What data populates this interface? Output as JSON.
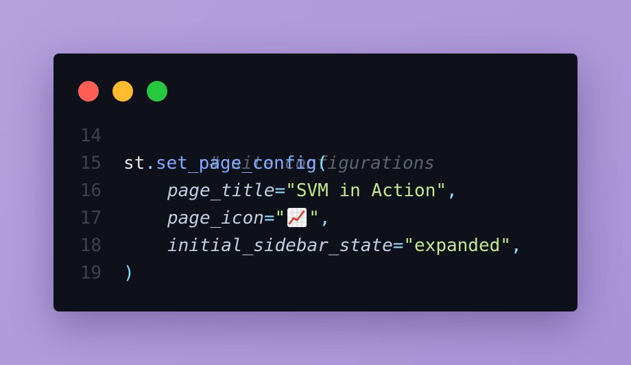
{
  "window": {
    "controls": [
      "close",
      "minimize",
      "maximize"
    ]
  },
  "code": {
    "lines": [
      {
        "number": "14",
        "comment": "# site configurations"
      },
      {
        "number": "15",
        "obj": "st",
        "dot": ".",
        "func": "set_page_config",
        "paren": "("
      },
      {
        "number": "16",
        "param": "page_title",
        "eq": "=",
        "value": "\"SVM in Action\"",
        "comma": ","
      },
      {
        "number": "17",
        "param": "page_icon",
        "eq": "=",
        "q1": "\"",
        "icon": "chart-increasing-icon",
        "q2": "\"",
        "comma": ","
      },
      {
        "number": "18",
        "param": "initial_sidebar_state",
        "eq": "=",
        "value": "\"expanded\"",
        "comma": ","
      },
      {
        "number": "19",
        "paren": ")"
      }
    ]
  },
  "colors": {
    "background": "#b39ddb",
    "window": "#0e1119",
    "red": "#ff5f57",
    "yellow": "#febc2e",
    "green": "#28c840",
    "string": "#c3e88d",
    "function": "#82aaff",
    "punctuation": "#89ddff"
  }
}
